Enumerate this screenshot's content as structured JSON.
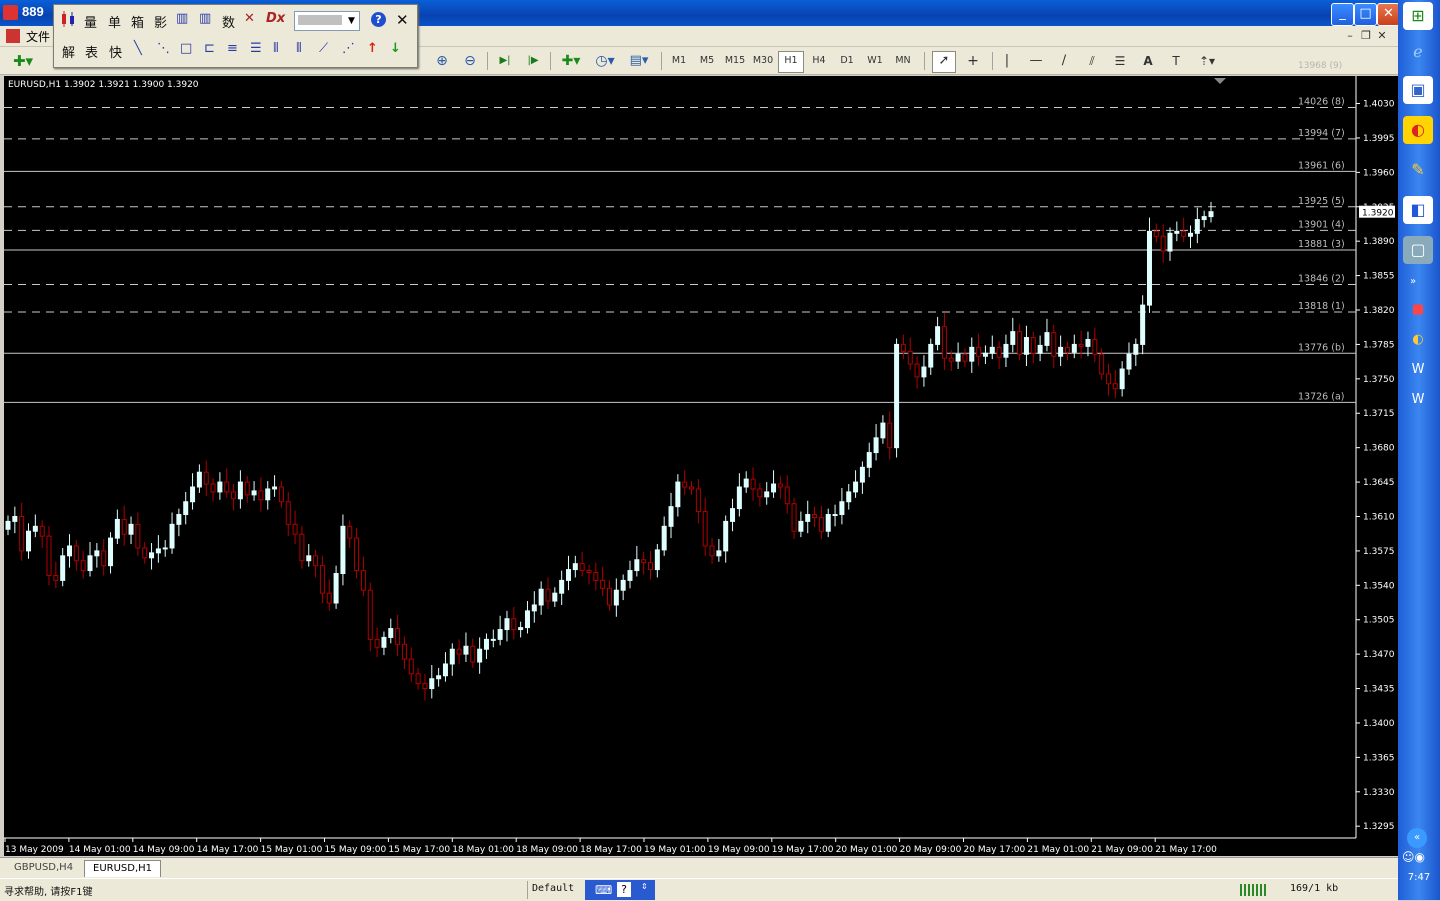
{
  "app": {
    "title": "889",
    "file_menu": "文件"
  },
  "window_buttons": {
    "minimize": "_",
    "maximize": "□",
    "close": "✕"
  },
  "float_toolbar": {
    "row1": [
      "量",
      "单",
      "箱",
      "影",
      "数"
    ],
    "row2": [
      "解",
      "表",
      "快"
    ],
    "help": "?",
    "close": "✕"
  },
  "toolbar": {
    "timeframes": [
      "M1",
      "M5",
      "M15",
      "M30",
      "H1",
      "H4",
      "D1",
      "W1",
      "MN"
    ],
    "active_timeframe": "H1",
    "text_tool": "A",
    "label_tool": "T",
    "overlay_label": "13968 (9)"
  },
  "chart_info": "EURUSD,H1  1.3902 1.3921 1.3900 1.3920",
  "chart_data": {
    "type": "candlestick",
    "symbol": "EURUSD",
    "timeframe": "H1",
    "ohlc_header": {
      "open": 1.3902,
      "high": 1.3921,
      "low": 1.39,
      "close": 1.392
    },
    "current_price_label": "1.3920",
    "ylim": [
      1.3283,
      1.4058
    ],
    "price_ticks": [
      "1.4030",
      "1.3995",
      "1.3960",
      "1.3925",
      "1.3890",
      "1.3855",
      "1.3820",
      "1.3785",
      "1.3750",
      "1.3715",
      "1.3680",
      "1.3645",
      "1.3610",
      "1.3575",
      "1.3540",
      "1.3505",
      "1.3470",
      "1.3435",
      "1.3400",
      "1.3365",
      "1.3330",
      "1.3295"
    ],
    "time_labels": [
      "13 May 2009",
      "14 May 01:00",
      "14 May 09:00",
      "14 May 17:00",
      "15 May 01:00",
      "15 May 09:00",
      "15 May 17:00",
      "18 May 01:00",
      "18 May 09:00",
      "18 May 17:00",
      "19 May 01:00",
      "19 May 09:00",
      "19 May 17:00",
      "20 May 01:00",
      "20 May 09:00",
      "20 May 17:00",
      "21 May 01:00",
      "21 May 09:00",
      "21 May 17:00"
    ],
    "levels": [
      {
        "label": "14026 (8)",
        "price": 1.4026,
        "style": "dashed"
      },
      {
        "label": "13994 (7)",
        "price": 1.3994,
        "style": "dashed"
      },
      {
        "label": "13961 (6)",
        "price": 1.3961,
        "style": "solid"
      },
      {
        "label": "13925 (5)",
        "price": 1.3925,
        "style": "dashed"
      },
      {
        "label": "13901 (4)",
        "price": 1.3901,
        "style": "dashed"
      },
      {
        "label": "13881 (3)",
        "price": 1.3881,
        "style": "solid"
      },
      {
        "label": "13846 (2)",
        "price": 1.3846,
        "style": "dashed"
      },
      {
        "label": "13818 (1)",
        "price": 1.3818,
        "style": "dashed"
      },
      {
        "label": "13776 (b)",
        "price": 1.3776,
        "style": "solid"
      },
      {
        "label": "13726 (a)",
        "price": 1.3726,
        "style": "solid"
      }
    ],
    "closes": [
      1.3605,
      1.361,
      1.3575,
      1.3595,
      1.36,
      1.359,
      1.355,
      1.3545,
      1.357,
      1.358,
      1.3565,
      1.3555,
      1.357,
      1.3575,
      1.356,
      1.3588,
      1.3607,
      1.3592,
      1.3602,
      1.3578,
      1.3568,
      1.3573,
      1.3577,
      1.3578,
      1.3602,
      1.3612,
      1.3625,
      1.364,
      1.3655,
      1.3643,
      1.3635,
      1.3645,
      1.3635,
      1.3628,
      1.3645,
      1.3632,
      1.3636,
      1.3627,
      1.3638,
      1.364,
      1.3625,
      1.3602,
      1.3592,
      1.3565,
      1.357,
      1.356,
      1.3532,
      1.3522,
      1.3552,
      1.36,
      1.3588,
      1.3555,
      1.3535,
      1.3485,
      1.3477,
      1.3487,
      1.3496,
      1.348,
      1.3465,
      1.345,
      1.344,
      1.3435,
      1.3445,
      1.3448,
      1.346,
      1.3475,
      1.347,
      1.3478,
      1.3462,
      1.3475,
      1.3485,
      1.3485,
      1.3495,
      1.3506,
      1.3495,
      1.3497,
      1.3514,
      1.352,
      1.3536,
      1.3524,
      1.3532,
      1.3545,
      1.3556,
      1.3562,
      1.3555,
      1.3553,
      1.3545,
      1.3537,
      1.352,
      1.3535,
      1.3545,
      1.3555,
      1.3566,
      1.3563,
      1.3556,
      1.3576,
      1.36,
      1.362,
      1.3645,
      1.364,
      1.3638,
      1.3615,
      1.358,
      1.357,
      1.3575,
      1.3605,
      1.3618,
      1.364,
      1.3648,
      1.3638,
      1.363,
      1.3635,
      1.3643,
      1.364,
      1.3623,
      1.3595,
      1.3605,
      1.3612,
      1.3609,
      1.3595,
      1.3612,
      1.3612,
      1.3625,
      1.3635,
      1.3645,
      1.366,
      1.3675,
      1.369,
      1.3705,
      1.368,
      1.3785,
      1.3778,
      1.3765,
      1.3752,
      1.3762,
      1.3785,
      1.3803,
      1.3771,
      1.3768,
      1.3775,
      1.3768,
      1.3782,
      1.3773,
      1.3776,
      1.3782,
      1.3772,
      1.3785,
      1.3798,
      1.3775,
      1.3792,
      1.3776,
      1.3784,
      1.3797,
      1.3773,
      1.3782,
      1.3777,
      1.3785,
      1.3783,
      1.379,
      1.3775,
      1.3755,
      1.3745,
      1.374,
      1.376,
      1.3775,
      1.3785,
      1.3825,
      1.39,
      1.3895,
      1.388,
      1.3898,
      1.39,
      1.3895,
      1.3898,
      1.3912,
      1.3915,
      1.392
    ]
  },
  "tabs": [
    "GBPUSD,H4",
    "EURUSD,H1"
  ],
  "active_tab": "EURUSD,H1",
  "status": {
    "help": "寻求帮助, 请按F1键",
    "profile": "Default",
    "traffic": "169/1 kb"
  },
  "taskbar": {
    "clock": "7:47"
  }
}
